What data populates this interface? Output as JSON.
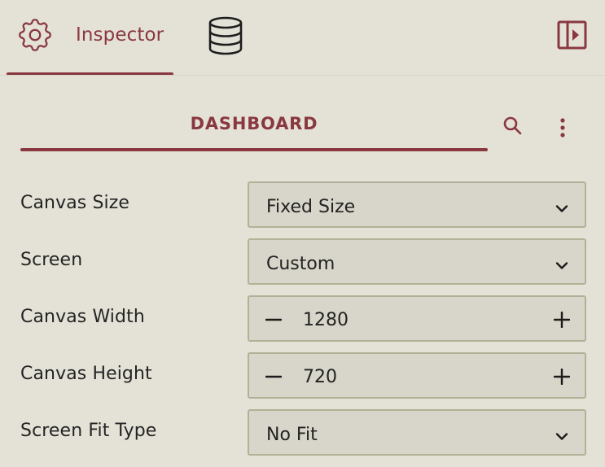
{
  "topbar": {
    "inspector_tab": {
      "label": "Inspector",
      "icon": "gear-icon"
    },
    "data_tab": {
      "icon": "database-icon"
    },
    "panel_toggle": {
      "icon": "collapse-panel-icon"
    }
  },
  "section": {
    "title": "DASHBOARD",
    "search_icon": "search-icon",
    "menu_icon": "more-vertical-icon"
  },
  "properties": [
    {
      "label": "Canvas Size",
      "type": "select",
      "value": "Fixed Size"
    },
    {
      "label": "Screen",
      "type": "select",
      "value": "Custom"
    },
    {
      "label": "Canvas Width",
      "type": "stepper",
      "value": "1280"
    },
    {
      "label": "Canvas Height",
      "type": "stepper",
      "value": "720"
    },
    {
      "label": "Screen Fit Type",
      "type": "select",
      "value": "No Fit"
    }
  ],
  "colors": {
    "background": "#e4e2d6",
    "accent": "#8a3840",
    "control_bg": "#d8d6ca",
    "control_border": "#b2b197"
  }
}
